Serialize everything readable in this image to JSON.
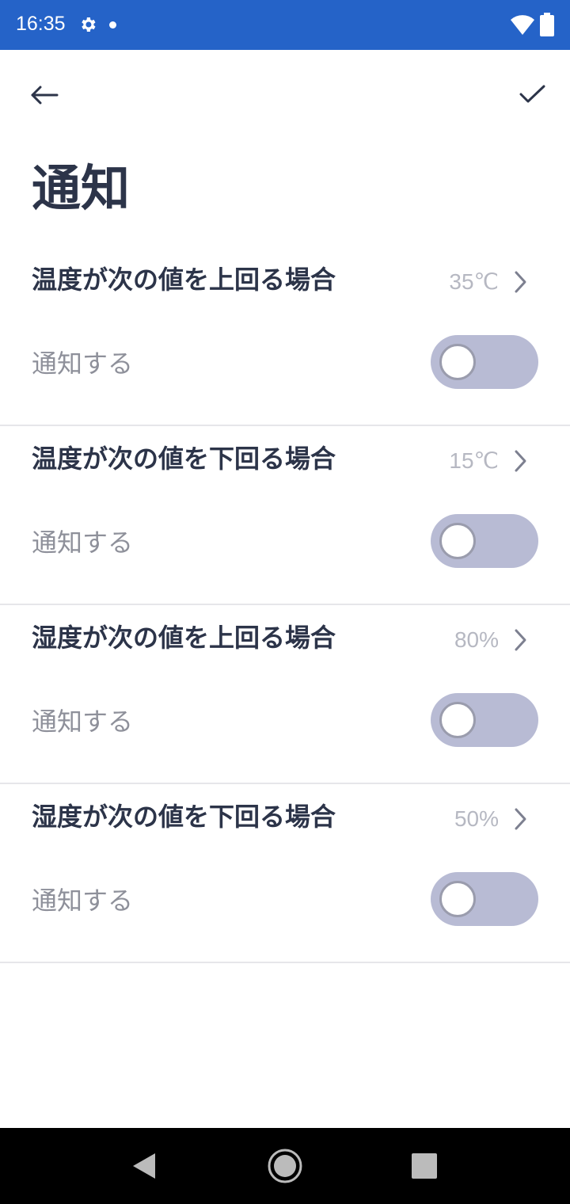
{
  "status_bar": {
    "time": "16:35",
    "icons": [
      "settings-icon",
      "notification-dot-icon",
      "wifi-icon",
      "battery-icon"
    ],
    "background": "#2563c8"
  },
  "toolbar": {
    "back_icon": "arrow-left-icon",
    "confirm_icon": "check-icon"
  },
  "page": {
    "title": "通知"
  },
  "sections": [
    {
      "title": "温度が次の値を上回る場合",
      "value": "35℃",
      "toggle_label": "通知する",
      "toggle_on": false
    },
    {
      "title": "温度が次の値を下回る場合",
      "value": "15℃",
      "toggle_label": "通知する",
      "toggle_on": false
    },
    {
      "title": "湿度が次の値を上回る場合",
      "value": "80%",
      "toggle_label": "通知する",
      "toggle_on": false
    },
    {
      "title": "湿度が次の値を下回る場合",
      "value": "50%",
      "toggle_label": "通知する",
      "toggle_on": false
    }
  ],
  "nav_bar": {
    "icons": [
      "nav-back-icon",
      "nav-home-icon",
      "nav-recents-icon"
    ]
  },
  "colors": {
    "title_text": "#2c3449",
    "value_text": "#b6b8c2",
    "label_text": "#8e909a",
    "toggle_track_off": "#b8bbd4"
  }
}
